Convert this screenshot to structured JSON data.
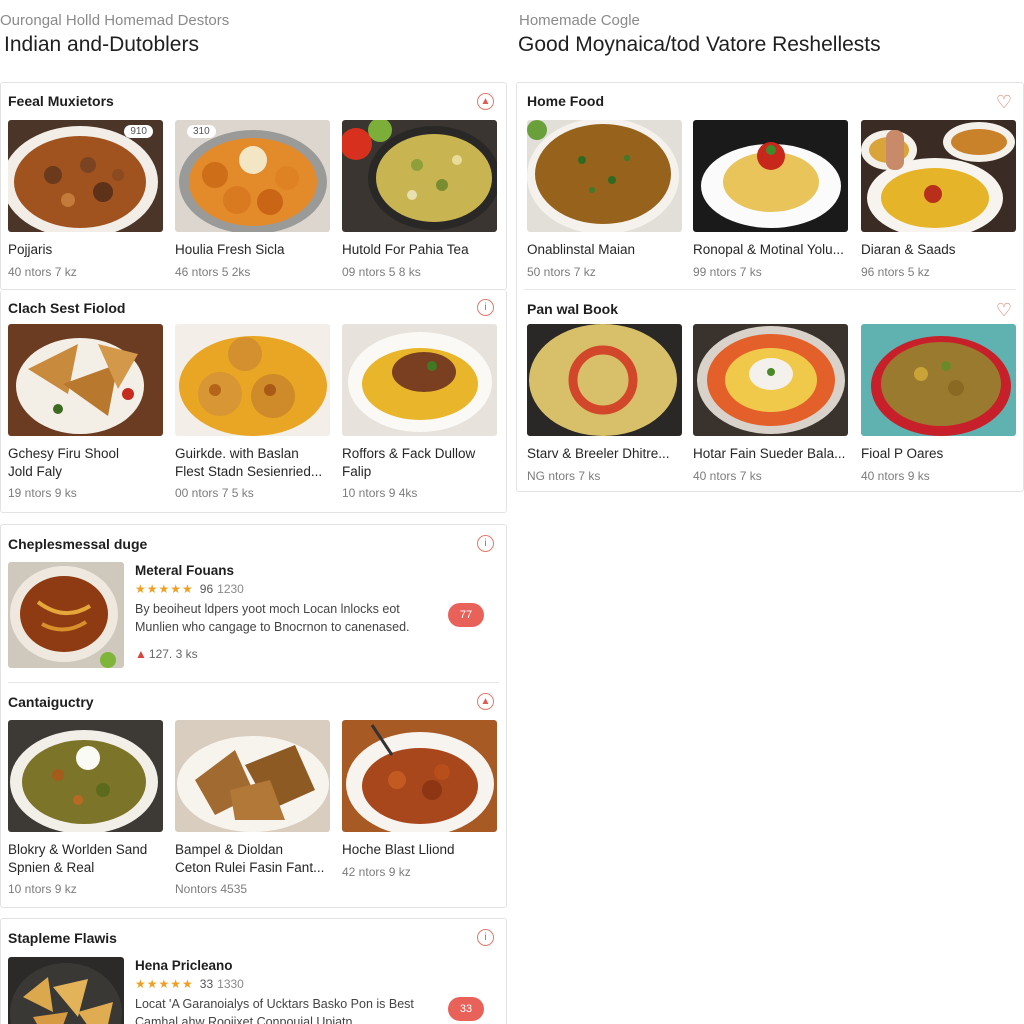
{
  "left_header": {
    "subtitle": "Ourongal Holld Homemad Destors",
    "title": "Indian and-Dutoblers"
  },
  "right_header": {
    "subtitle": "Homemade Cogle",
    "title": "Good Moynaica/tod Vatore Reshellests"
  },
  "sections": {
    "feal": {
      "title": "Feeal Muxietors",
      "icon": "flame-icon",
      "items": [
        {
          "name": "Pojjaris",
          "meta": "40 ntors 7 kz",
          "badge": "910"
        },
        {
          "name": "Houlia Fresh Sicla",
          "meta": "46 ntors 5 2ks",
          "badge": "310"
        },
        {
          "name": "Hutold For Pahia Tea",
          "meta": "09 ntors 5 8 ks"
        }
      ]
    },
    "clach": {
      "title": "Clach Sest Fiolod",
      "icon": "info-icon",
      "items": [
        {
          "name": "Gchesy Firu Shool",
          "name2": "Jold Faly",
          "meta": "19 ntors 9 ks"
        },
        {
          "name": "Guirkde. with Baslan",
          "name2": "Flest Stadn Sesienried...",
          "meta": "00 ntors 7 5 ks"
        },
        {
          "name": "Roffors & Fack Dullow",
          "name2": "Falip",
          "meta": "10 ntors 9 4ks"
        }
      ]
    },
    "cheples": {
      "title": "Cheplesmessal duge",
      "icon": "info-icon",
      "featured": {
        "title": "Meteral Fouans",
        "stars": "★★★★★",
        "rating": "96",
        "rating_count": "1230",
        "desc": "By beoiheut ldpers yoot moch Locan lnlocks eot Munlien who cangage to Bnocrnon to canenased.",
        "meta": "127. 3 ks",
        "pill": "77"
      }
    },
    "cantaigu": {
      "title": "Cantaiguctry",
      "icon": "flame-icon",
      "items": [
        {
          "name": "Blokry & Worlden Sand",
          "name2": "Spnien & Real",
          "meta": "10 ntors 9 kz"
        },
        {
          "name": "Bampel & Dioldan",
          "name2": "Ceton Rulei Fasin Fant...",
          "meta": "Nontors 4535"
        },
        {
          "name": "Hoche Blast Lliond",
          "meta": "42 ntors 9 kz"
        }
      ]
    },
    "stapleme": {
      "title": "Stapleme Flawis",
      "icon": "info-icon",
      "featured": {
        "title": "Hena Pricleano",
        "stars": "★★★★★",
        "rating": "33",
        "rating_count": "1330",
        "desc": "Locat 'A Garanoialys of Ucktars Basko Pon is Best Camhal ahw Rooiixet Conpouial Upiatn",
        "pill": "33"
      }
    },
    "home_food": {
      "title": "Home Food",
      "icon": "heart-icon",
      "items": [
        {
          "name": "Onablinstal Maian",
          "meta": "50 ntors 7 kz"
        },
        {
          "name": "Ronopal & Motinal Yolu...",
          "meta": "99 ntors 7 ks"
        },
        {
          "name": "Diaran & Saads",
          "meta": "96 ntors 5 kz"
        }
      ]
    },
    "pan_wal": {
      "title": "Pan wal Book",
      "icon": "heart-icon",
      "items": [
        {
          "name": "Starv & Breeler Dhitre...",
          "meta": "NG ntors 7 ks"
        },
        {
          "name": "Hotar Fain Sueder Bala...",
          "meta": "40 ntors 7 ks"
        },
        {
          "name": "Fioal P Oares",
          "meta": "40 ntors 9 ks"
        }
      ]
    }
  },
  "colors": {
    "accent": "#e8625a",
    "star": "#f0a020",
    "border": "#e3e3e3"
  }
}
